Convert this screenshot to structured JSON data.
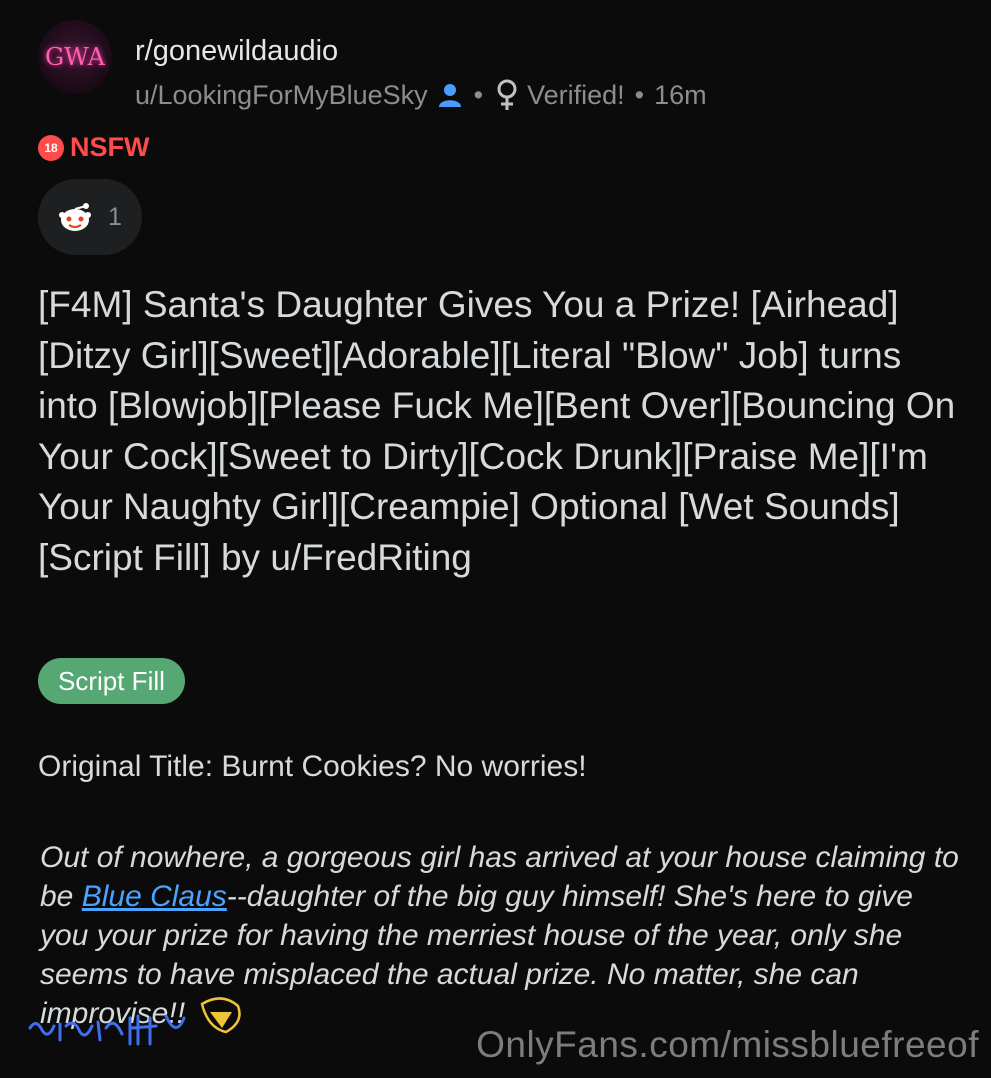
{
  "header": {
    "subreddit": "r/gonewildaudio",
    "avatar_text": "GWA",
    "username": "u/LookingForMyBlueSky",
    "verified": "Verified!",
    "separator": "•",
    "time": "16m"
  },
  "nsfw": {
    "badge": "18",
    "label": "NSFW"
  },
  "award": {
    "icon": "reddit-snoo-award-icon",
    "count": "1"
  },
  "post": {
    "title": "[F4M] Santa's Daughter Gives You a Prize! [Airhead][Ditzy Girl][Sweet][Adorable][Literal \"Blow\" Job] turns into [Blowjob][Please Fuck Me][Bent Over][Bouncing On Your Cock][Sweet to Dirty][Cock Drunk][Praise Me][I'm Your Naughty Girl][Creampie] Optional [Wet Sounds] [Script Fill] by u/FredRiting",
    "flair": "Script Fill",
    "original_title": "Original Title: Burnt Cookies? No worries!",
    "para_before": "Out of nowhere, a gorgeous girl has arrived at your house claiming to be ",
    "para_link": "Blue Claus",
    "para_after": "--daughter of the big guy himself! She's here to give you your prize for having the merriest house of the year, only she seems to have misplaced the actual prize. No matter, she can improvise!!"
  },
  "watermark": "OnlyFans.com/missbluefreeof",
  "colors": {
    "background": "#0b0b0b",
    "nsfw": "#ff4b4b",
    "flair": "#55a773",
    "link": "#4aa3ff",
    "user_icon": "#4a9dff"
  }
}
